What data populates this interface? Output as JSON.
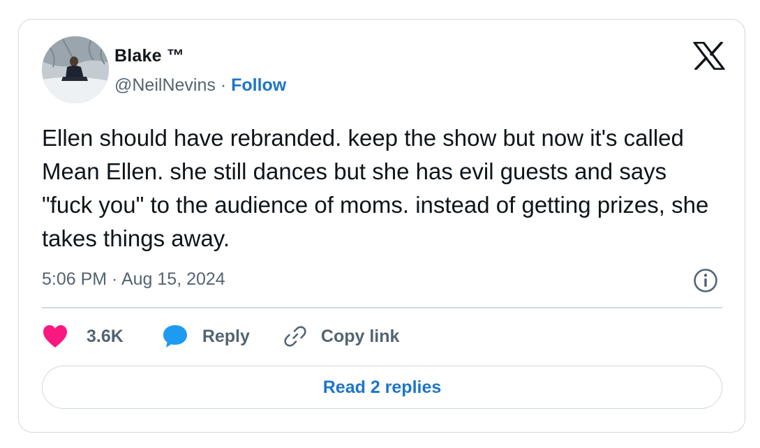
{
  "author": {
    "display_name": "Blake ™",
    "handle": "@NeilNevins",
    "separator": " · ",
    "follow_label": "Follow",
    "avatar_icon": "profile-photo"
  },
  "tweet": {
    "text": "Ellen should have rebranded. keep the show but now it's called Mean Ellen. she still dances but she has evil guests and says \"fuck you\" to the audience of moms. instead of getting prizes, she takes things away.",
    "time": "5:06 PM",
    "date_separator": " · ",
    "date": "Aug 15, 2024"
  },
  "actions": {
    "like_count": "3.6K",
    "reply_label": "Reply",
    "copy_link_label": "Copy link"
  },
  "footer": {
    "read_replies_label": "Read 2 replies"
  },
  "icons": {
    "brand": "x-logo",
    "info": "info-icon",
    "like": "heart-icon",
    "reply": "speech-bubble-icon",
    "copy": "link-icon"
  },
  "colors": {
    "like": "#f91880",
    "reply": "#1d9bf0",
    "link_blue": "#1d75c9",
    "muted": "#536471",
    "border": "#cfd9de"
  }
}
